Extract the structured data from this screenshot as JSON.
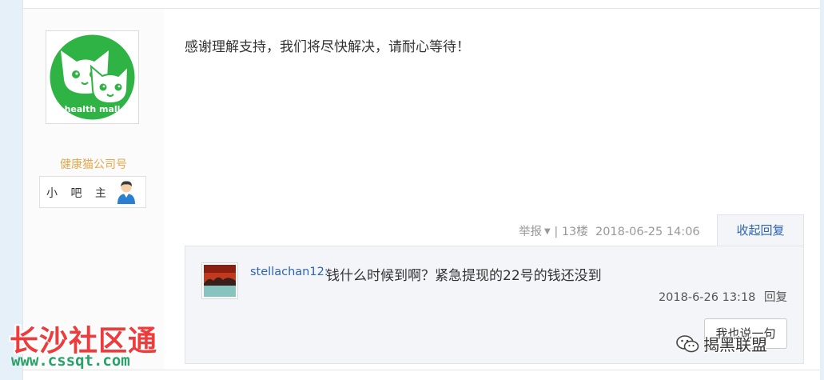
{
  "author": {
    "name": "健康猫公司号",
    "badge_label": "小 吧 主",
    "logo_text": "health mall"
  },
  "post": {
    "text": "感谢理解支持，我们将尽快解决，请耐心等待！",
    "report_label": "举报",
    "separator": "|",
    "floor": "13楼",
    "datetime": "2018-06-25 14:06",
    "collapse_reply_label": "收起回复"
  },
  "reply": {
    "username": "stellachan12:",
    "text": "钱什么时候到啊？紧急提现的22号的钱还没到",
    "datetime": "2018-6-26 13:18",
    "reply_link": "回复",
    "say_button": "我也说一句"
  },
  "watermarks": {
    "site_cn": "长沙社区通",
    "site_url": "www.cssqt.com",
    "right_text": "揭黑联盟"
  },
  "colors": {
    "brand_green": "#2eb344",
    "link_blue": "#2d64b3",
    "author_orange": "#e6a74b",
    "watermark_red": "#ee3b3b"
  }
}
